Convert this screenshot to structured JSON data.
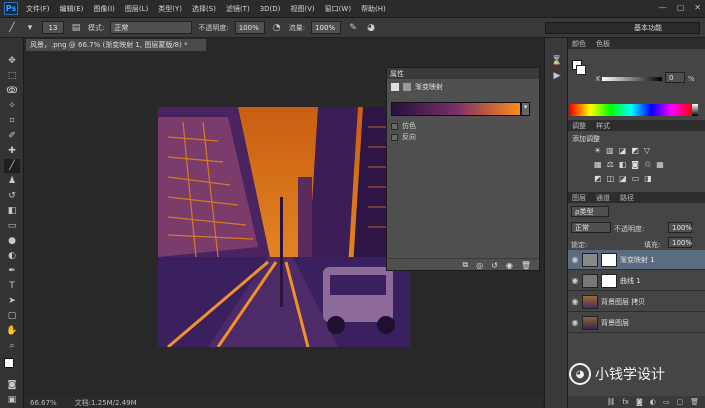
{
  "menubar": {
    "logo": "Ps",
    "items": [
      "文件(F)",
      "编辑(E)",
      "图像(I)",
      "图层(L)",
      "类型(Y)",
      "选择(S)",
      "滤镜(T)",
      "3D(D)",
      "视图(V)",
      "窗口(W)",
      "帮助(H)"
    ],
    "controls": [
      "—",
      "▢",
      "✕"
    ]
  },
  "options": {
    "brush_size": "13",
    "mode_label": "模式:",
    "mode_value": "正常",
    "opacity_label": "不透明度:",
    "opacity_value": "100%",
    "flow_label": "流量:",
    "flow_value": "100%",
    "workspace": "基本功能"
  },
  "document": {
    "tab": "风景，.png @ 66.7% (渐变映射 1, 图层蒙版/8) *",
    "zoom": "66.67%",
    "doc_info": "文档:1.25M/2.49M"
  },
  "properties": {
    "title": "属性",
    "header": "渐变映射",
    "dither": "仿色",
    "reverse": "反向"
  },
  "panels": {
    "color_tabs": [
      "颜色",
      "色板"
    ],
    "k_label": "K",
    "k_value": "0",
    "k_unit": "%",
    "adjust_tabs": [
      "调整",
      "样式"
    ],
    "adjust_title": "添加调整",
    "layer_tabs": [
      "图层",
      "通道",
      "路径"
    ],
    "filter_kind": "ρ类型",
    "blend_mode": "正常",
    "opacity_label": "不透明度:",
    "opacity_value": "100%",
    "lock_label": "锁定:",
    "fill_label": "填充:",
    "fill_value": "100%"
  },
  "layers": [
    {
      "name": "渐变映射 1"
    },
    {
      "name": "曲线 1"
    },
    {
      "name": "背景图层 拷贝"
    },
    {
      "name": "背景图层"
    }
  ],
  "watermark": "小钱学设计"
}
